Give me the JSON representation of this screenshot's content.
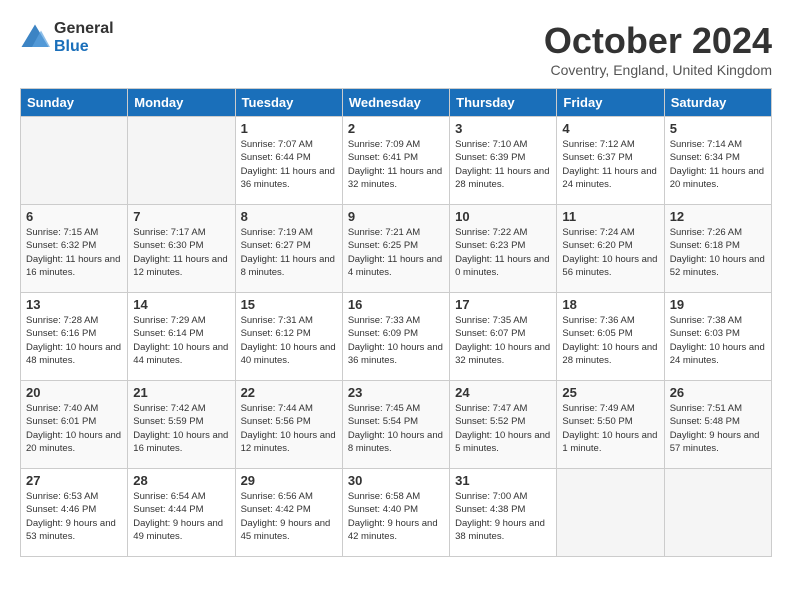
{
  "header": {
    "logo_general": "General",
    "logo_blue": "Blue",
    "month_title": "October 2024",
    "location": "Coventry, England, United Kingdom"
  },
  "days_of_week": [
    "Sunday",
    "Monday",
    "Tuesday",
    "Wednesday",
    "Thursday",
    "Friday",
    "Saturday"
  ],
  "weeks": [
    [
      {
        "day": "",
        "info": ""
      },
      {
        "day": "",
        "info": ""
      },
      {
        "day": "1",
        "info": "Sunrise: 7:07 AM\nSunset: 6:44 PM\nDaylight: 11 hours and 36 minutes."
      },
      {
        "day": "2",
        "info": "Sunrise: 7:09 AM\nSunset: 6:41 PM\nDaylight: 11 hours and 32 minutes."
      },
      {
        "day": "3",
        "info": "Sunrise: 7:10 AM\nSunset: 6:39 PM\nDaylight: 11 hours and 28 minutes."
      },
      {
        "day": "4",
        "info": "Sunrise: 7:12 AM\nSunset: 6:37 PM\nDaylight: 11 hours and 24 minutes."
      },
      {
        "day": "5",
        "info": "Sunrise: 7:14 AM\nSunset: 6:34 PM\nDaylight: 11 hours and 20 minutes."
      }
    ],
    [
      {
        "day": "6",
        "info": "Sunrise: 7:15 AM\nSunset: 6:32 PM\nDaylight: 11 hours and 16 minutes."
      },
      {
        "day": "7",
        "info": "Sunrise: 7:17 AM\nSunset: 6:30 PM\nDaylight: 11 hours and 12 minutes."
      },
      {
        "day": "8",
        "info": "Sunrise: 7:19 AM\nSunset: 6:27 PM\nDaylight: 11 hours and 8 minutes."
      },
      {
        "day": "9",
        "info": "Sunrise: 7:21 AM\nSunset: 6:25 PM\nDaylight: 11 hours and 4 minutes."
      },
      {
        "day": "10",
        "info": "Sunrise: 7:22 AM\nSunset: 6:23 PM\nDaylight: 11 hours and 0 minutes."
      },
      {
        "day": "11",
        "info": "Sunrise: 7:24 AM\nSunset: 6:20 PM\nDaylight: 10 hours and 56 minutes."
      },
      {
        "day": "12",
        "info": "Sunrise: 7:26 AM\nSunset: 6:18 PM\nDaylight: 10 hours and 52 minutes."
      }
    ],
    [
      {
        "day": "13",
        "info": "Sunrise: 7:28 AM\nSunset: 6:16 PM\nDaylight: 10 hours and 48 minutes."
      },
      {
        "day": "14",
        "info": "Sunrise: 7:29 AM\nSunset: 6:14 PM\nDaylight: 10 hours and 44 minutes."
      },
      {
        "day": "15",
        "info": "Sunrise: 7:31 AM\nSunset: 6:12 PM\nDaylight: 10 hours and 40 minutes."
      },
      {
        "day": "16",
        "info": "Sunrise: 7:33 AM\nSunset: 6:09 PM\nDaylight: 10 hours and 36 minutes."
      },
      {
        "day": "17",
        "info": "Sunrise: 7:35 AM\nSunset: 6:07 PM\nDaylight: 10 hours and 32 minutes."
      },
      {
        "day": "18",
        "info": "Sunrise: 7:36 AM\nSunset: 6:05 PM\nDaylight: 10 hours and 28 minutes."
      },
      {
        "day": "19",
        "info": "Sunrise: 7:38 AM\nSunset: 6:03 PM\nDaylight: 10 hours and 24 minutes."
      }
    ],
    [
      {
        "day": "20",
        "info": "Sunrise: 7:40 AM\nSunset: 6:01 PM\nDaylight: 10 hours and 20 minutes."
      },
      {
        "day": "21",
        "info": "Sunrise: 7:42 AM\nSunset: 5:59 PM\nDaylight: 10 hours and 16 minutes."
      },
      {
        "day": "22",
        "info": "Sunrise: 7:44 AM\nSunset: 5:56 PM\nDaylight: 10 hours and 12 minutes."
      },
      {
        "day": "23",
        "info": "Sunrise: 7:45 AM\nSunset: 5:54 PM\nDaylight: 10 hours and 8 minutes."
      },
      {
        "day": "24",
        "info": "Sunrise: 7:47 AM\nSunset: 5:52 PM\nDaylight: 10 hours and 5 minutes."
      },
      {
        "day": "25",
        "info": "Sunrise: 7:49 AM\nSunset: 5:50 PM\nDaylight: 10 hours and 1 minute."
      },
      {
        "day": "26",
        "info": "Sunrise: 7:51 AM\nSunset: 5:48 PM\nDaylight: 9 hours and 57 minutes."
      }
    ],
    [
      {
        "day": "27",
        "info": "Sunrise: 6:53 AM\nSunset: 4:46 PM\nDaylight: 9 hours and 53 minutes."
      },
      {
        "day": "28",
        "info": "Sunrise: 6:54 AM\nSunset: 4:44 PM\nDaylight: 9 hours and 49 minutes."
      },
      {
        "day": "29",
        "info": "Sunrise: 6:56 AM\nSunset: 4:42 PM\nDaylight: 9 hours and 45 minutes."
      },
      {
        "day": "30",
        "info": "Sunrise: 6:58 AM\nSunset: 4:40 PM\nDaylight: 9 hours and 42 minutes."
      },
      {
        "day": "31",
        "info": "Sunrise: 7:00 AM\nSunset: 4:38 PM\nDaylight: 9 hours and 38 minutes."
      },
      {
        "day": "",
        "info": ""
      },
      {
        "day": "",
        "info": ""
      }
    ]
  ]
}
